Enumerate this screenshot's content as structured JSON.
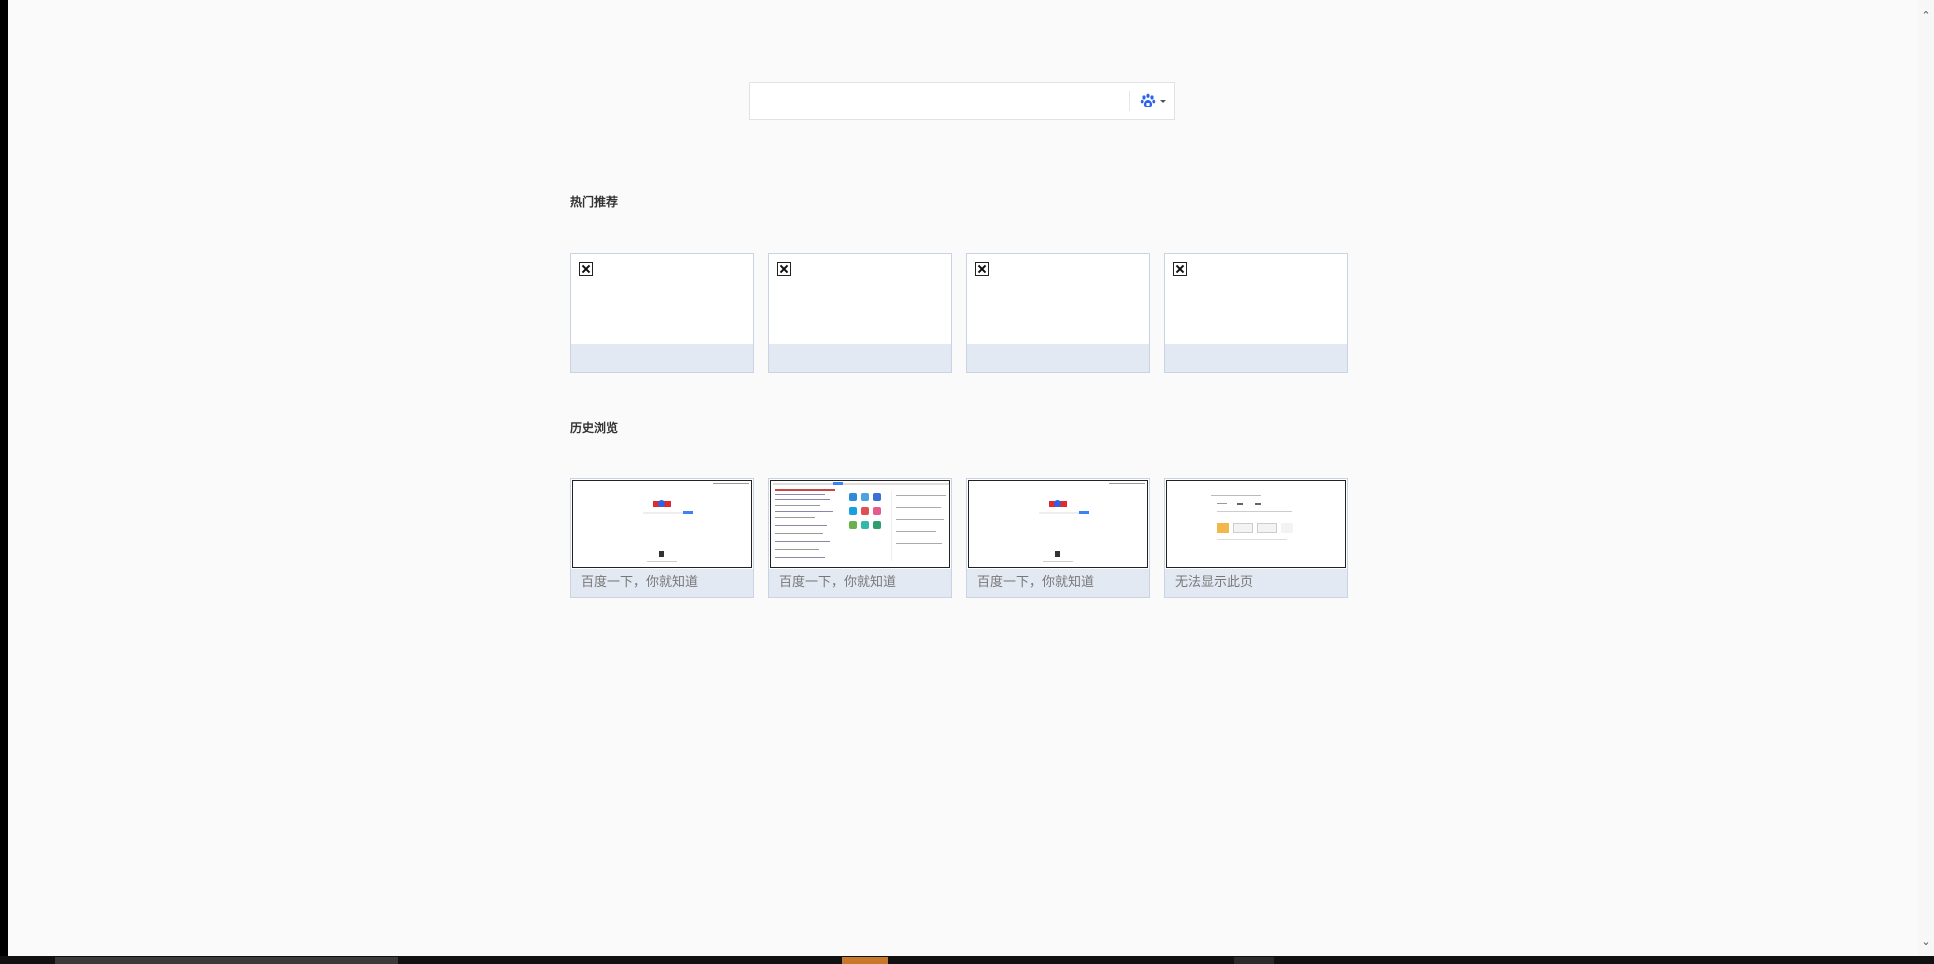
{
  "search": {
    "placeholder": "",
    "value": "",
    "engine_icon": "baidu-paw-icon",
    "engine_color": "#2b64e8"
  },
  "sections": {
    "hot": {
      "title": "热门推荐",
      "tiles": [
        {
          "title": "",
          "thumbnail": "broken-image-icon"
        },
        {
          "title": "",
          "thumbnail": "broken-image-icon"
        },
        {
          "title": "",
          "thumbnail": "broken-image-icon"
        },
        {
          "title": "",
          "thumbnail": "broken-image-icon"
        }
      ]
    },
    "history": {
      "title": "历史浏览",
      "tiles": [
        {
          "title": "百度一下，你就知道",
          "thumbnail": "baidu-home-screenshot"
        },
        {
          "title": "百度一下，你就知道",
          "thumbnail": "baidu-portal-screenshot"
        },
        {
          "title": "百度一下，你就知道",
          "thumbnail": "baidu-home-screenshot"
        },
        {
          "title": "无法显示此页",
          "thumbnail": "error-page-screenshot"
        }
      ]
    }
  },
  "colors": {
    "page_bg": "#fafafa",
    "tile_footer": "#e3e9f3",
    "tile_border": "#c9d3e3",
    "taskbar_accent": "#c9772a"
  }
}
